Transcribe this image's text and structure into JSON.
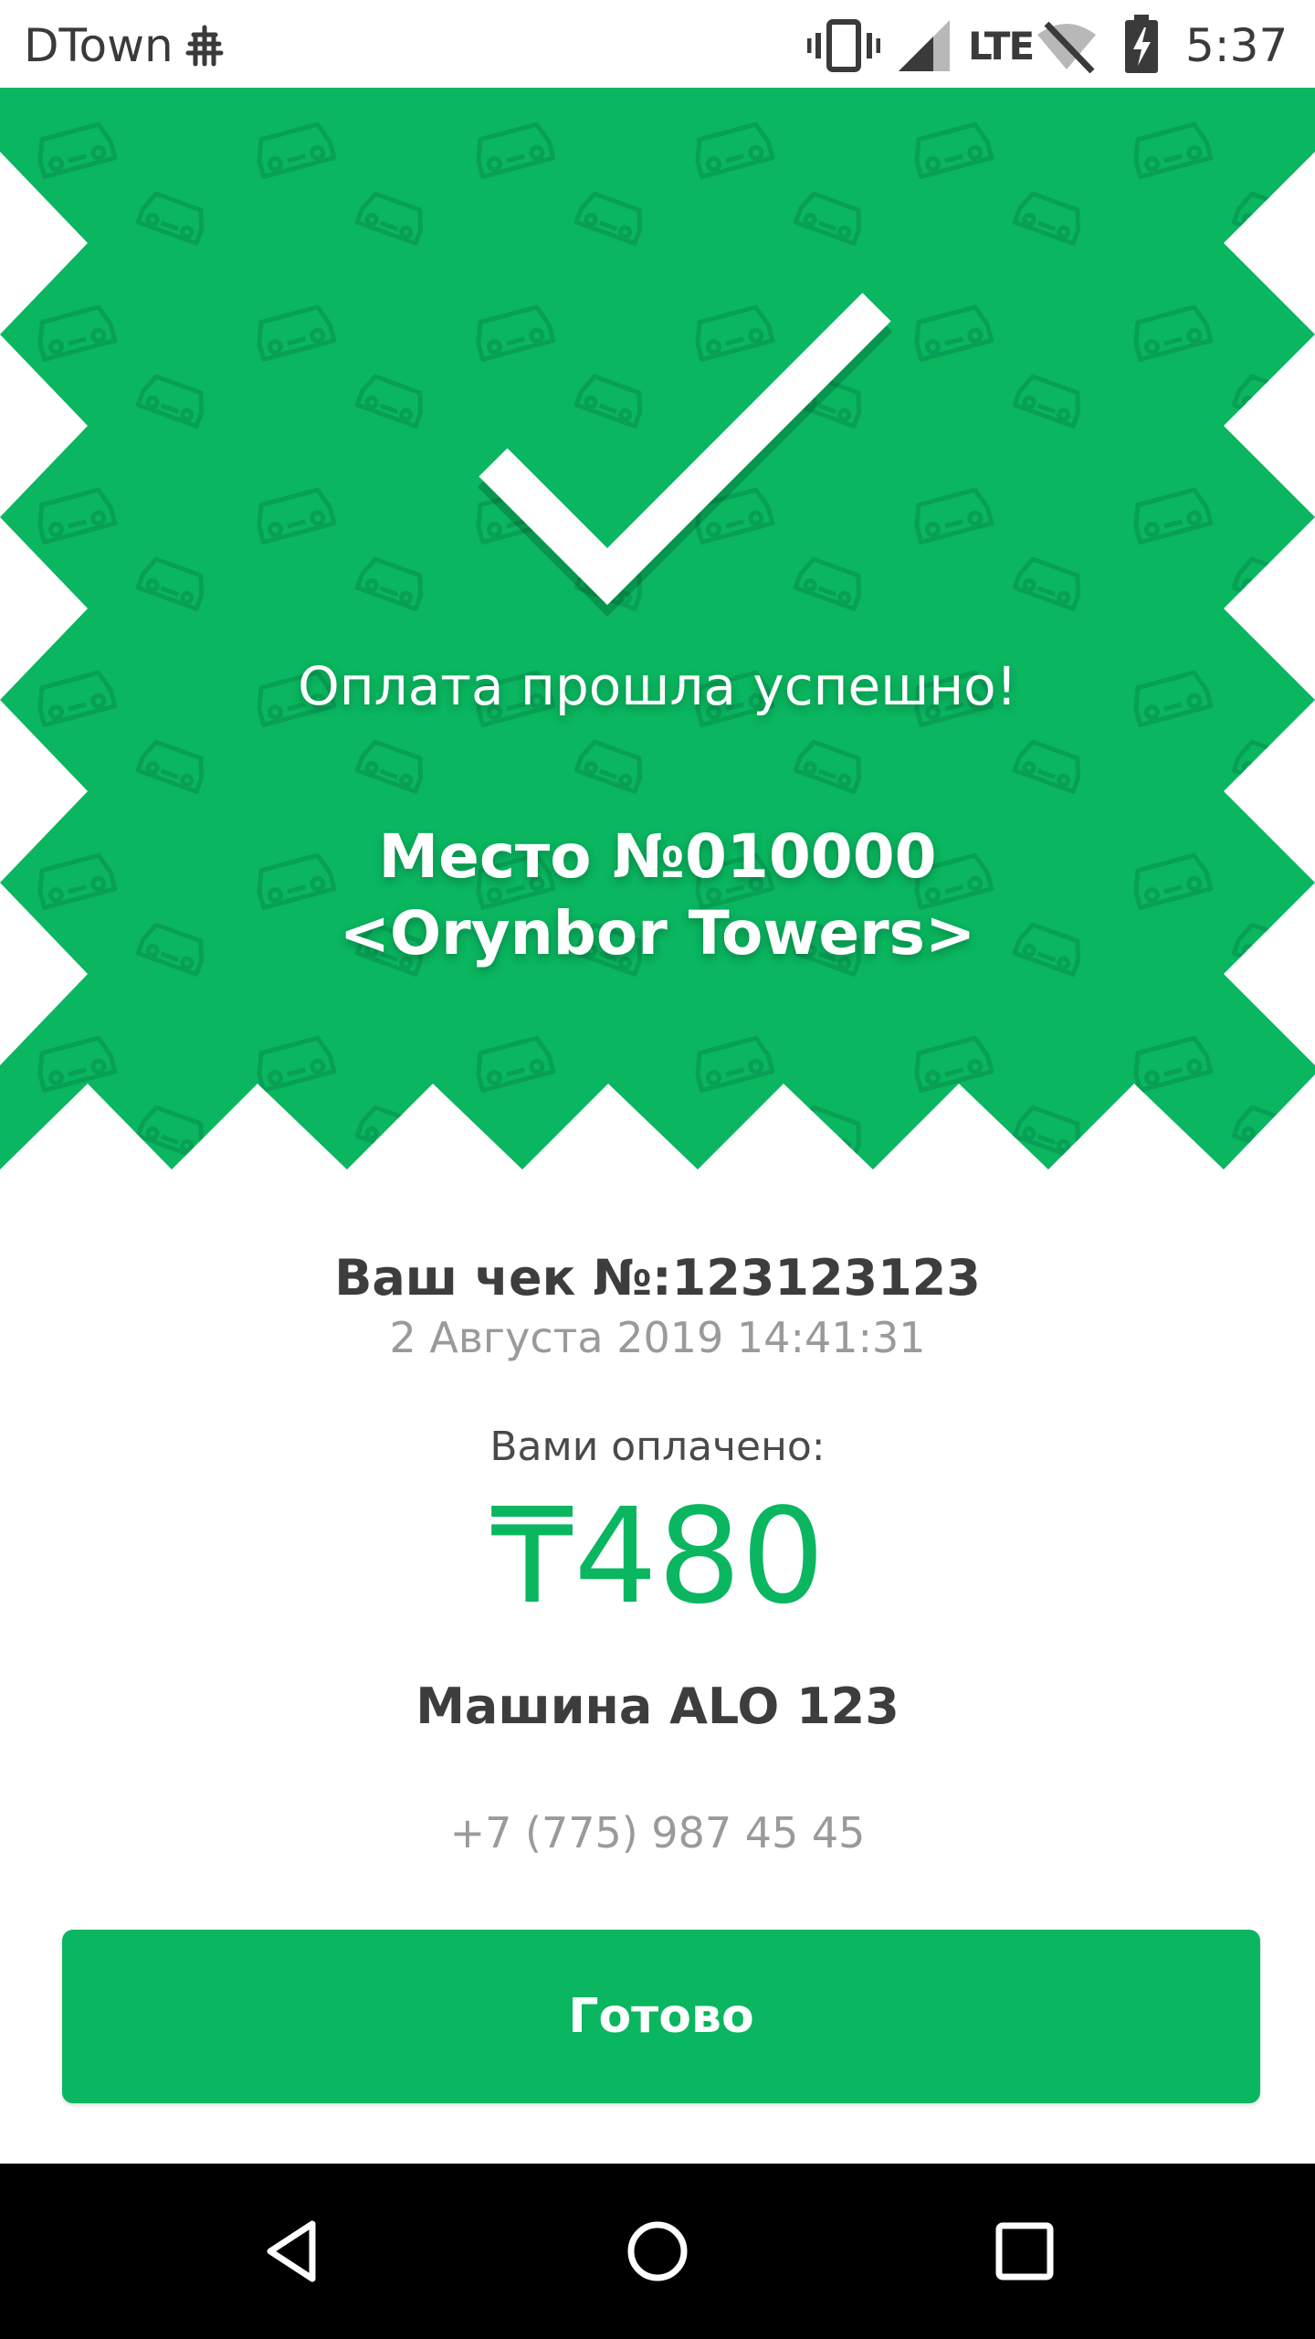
{
  "status_bar": {
    "carrier": "DTown",
    "network": "LTE",
    "time": "5:37",
    "icons": [
      "carrier-tree-icon",
      "vibrate-icon",
      "signal-icon",
      "wifi-off-icon",
      "battery-charging-icon"
    ]
  },
  "banner": {
    "icon": "checkmark-icon",
    "success_message": "Оплата прошла успешно!",
    "place_title": "Место №010000",
    "place_name": "<Orynbor Towers>",
    "background_color": "#0ab65f",
    "pattern_icon": "car-icon"
  },
  "receipt": {
    "title": "Ваш чек №:123123123",
    "date": "2 Августа 2019 14:41:31",
    "paid_label": "Вами оплачено:",
    "amount": "₸480",
    "car": "Машина ALO 123",
    "phone": "+7 (775) 987 45 45"
  },
  "actions": {
    "done_label": "Готово",
    "accent_color": "#0ab65f"
  },
  "nav_bar": {
    "icons": [
      "back-icon",
      "home-icon",
      "recents-icon"
    ]
  }
}
